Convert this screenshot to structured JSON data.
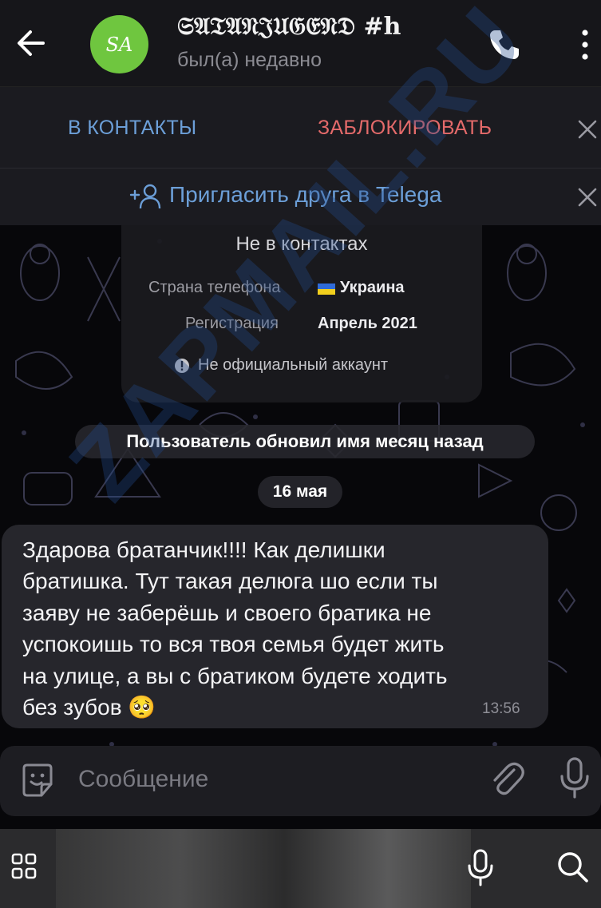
{
  "header": {
    "avatar_initials": "SA",
    "title": "𝔖𝔄𝔗𝔄𝔑𝔍𝔘𝔊𝔈𝔑𝔇 #h",
    "status": "был(а) недавно",
    "back_icon": "arrow-left-icon",
    "call_icon": "phone-icon",
    "menu_icon": "more-vertical-icon"
  },
  "action_bar": {
    "add_contact_label": "В КОНТАКТЫ",
    "block_label": "ЗАБЛОКИРОВАТЬ"
  },
  "invite_bar": {
    "label": "Пригласить друга в Telega"
  },
  "info_card": {
    "not_in_contacts": "Не в контактах",
    "country_label": "Страна телефона",
    "country_value": "Украина",
    "registration_label": "Регистрация",
    "registration_value": "Апрель 2021",
    "unofficial": "Не официальный аккаунт"
  },
  "service": {
    "name_update": "Пользователь обновил имя месяц назад",
    "date": "16 мая"
  },
  "message": {
    "text": "Здарова братанчик!!!! Как делишки\nбратишка. Тут такая делюга шо если ты\nзаяву не заберёшь и своего братика не\nуспокоишь то вся твоя семья будет жить\nна улице, а вы с братиком будете ходить\nбез зубов 🥺",
    "time": "13:56"
  },
  "input": {
    "placeholder": "Сообщение"
  },
  "watermark": "ZAPMAIL.RU",
  "colors": {
    "accent_blue": "#6c9fd8",
    "block_red": "#e46a6a",
    "avatar_green": "#6fc63f"
  }
}
